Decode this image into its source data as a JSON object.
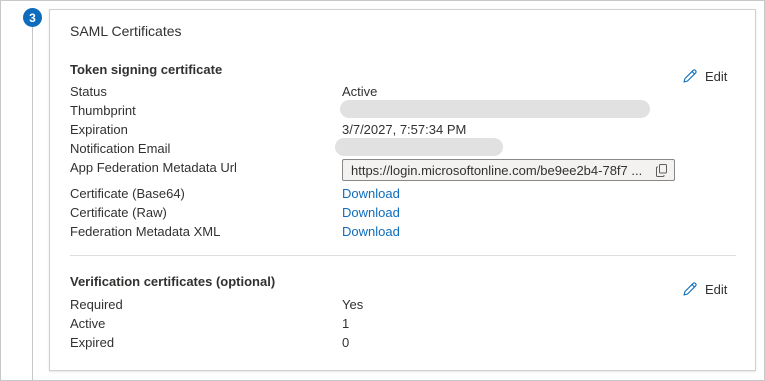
{
  "step": {
    "number": "3"
  },
  "card": {
    "title": "SAML Certificates"
  },
  "token_signing": {
    "heading": "Token signing certificate",
    "edit_label": "Edit",
    "rows": [
      {
        "label": "Status",
        "value": "Active"
      },
      {
        "label": "Thumbprint",
        "value": ""
      },
      {
        "label": "Expiration",
        "value": "3/7/2027, 7:57:34 PM"
      },
      {
        "label": "Notification Email",
        "value": ""
      },
      {
        "label": "App Federation Metadata Url",
        "value": "https://login.microsoftonline.com/be9ee2b4-78f7 ..."
      },
      {
        "label": "Certificate (Base64)",
        "value": "Download"
      },
      {
        "label": "Certificate (Raw)",
        "value": "Download"
      },
      {
        "label": "Federation Metadata XML",
        "value": "Download"
      }
    ]
  },
  "verification": {
    "heading": "Verification certificates (optional)",
    "edit_label": "Edit",
    "rows": [
      {
        "label": "Required",
        "value": "Yes"
      },
      {
        "label": "Active",
        "value": "1"
      },
      {
        "label": "Expired",
        "value": "0"
      }
    ]
  },
  "icons": {
    "edit": "pencil-icon",
    "copy": "copy-icon"
  },
  "colors": {
    "accent": "#0f6cbd",
    "redacted": "#e1e1e1"
  }
}
